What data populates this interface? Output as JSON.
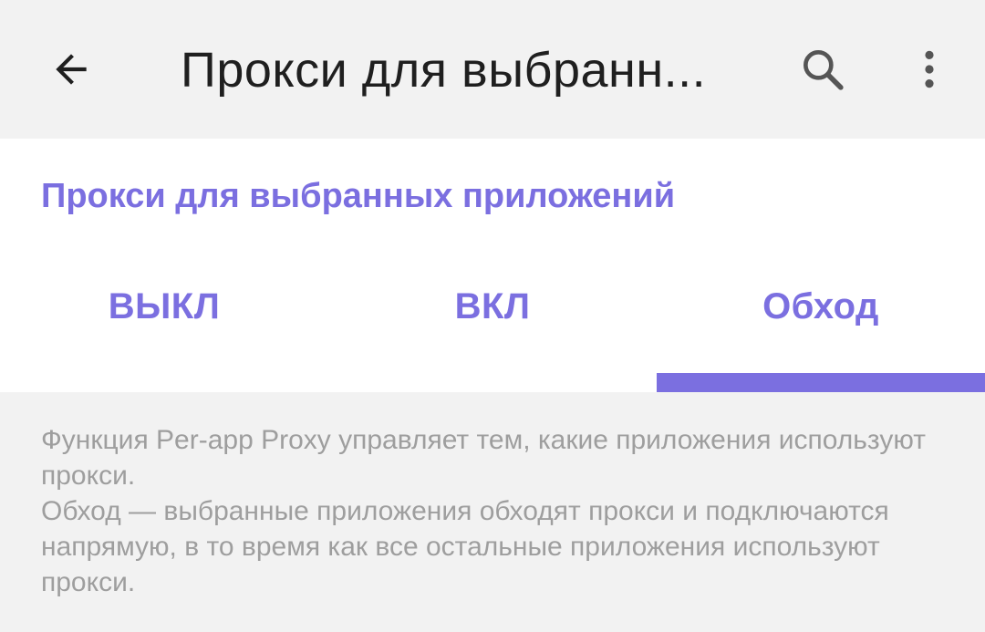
{
  "app_bar": {
    "title": "Прокси для выбранн...",
    "back_icon": "arrow-left-icon",
    "search_icon": "search-icon",
    "more_icon": "more-vert-icon"
  },
  "section": {
    "title": "Прокси для выбранных приложений"
  },
  "tabs": [
    {
      "label": "ВЫКЛ",
      "selected": false
    },
    {
      "label": "ВКЛ",
      "selected": false
    },
    {
      "label": "Обход",
      "selected": true
    }
  ],
  "description": {
    "line1": "Функция Per-app Proxy управляет тем, какие приложения используют прокси.",
    "line2": "Обход — выбранные приложения обходят прокси и подключаются напрямую, в то время как все остальные приложения используют прокси."
  },
  "colors": {
    "accent": "#7b6fe0",
    "text_primary": "#1f1f1f",
    "text_secondary": "#9e9e9e",
    "app_bar_bg": "#f2f2f2",
    "card_bg": "#ffffff"
  }
}
